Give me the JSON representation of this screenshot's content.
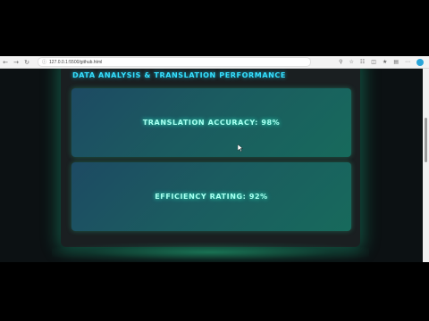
{
  "browser": {
    "url": "127.0.0.1:5500/github.html",
    "back_icon": "arrow-left-icon",
    "forward_icon": "arrow-right-icon",
    "reload_icon": "reload-icon"
  },
  "page": {
    "title": "DATA ANALYSIS & TRANSLATION PERFORMANCE",
    "cards": [
      {
        "label": "TRANSLATION ACCURACY: 98%"
      },
      {
        "label": "EFFICIENCY RATING: 92%"
      }
    ]
  },
  "colors": {
    "accent": "#35e0ff",
    "card_text": "#a8fff0",
    "glow": "#28d090",
    "background": "#0c1113"
  }
}
